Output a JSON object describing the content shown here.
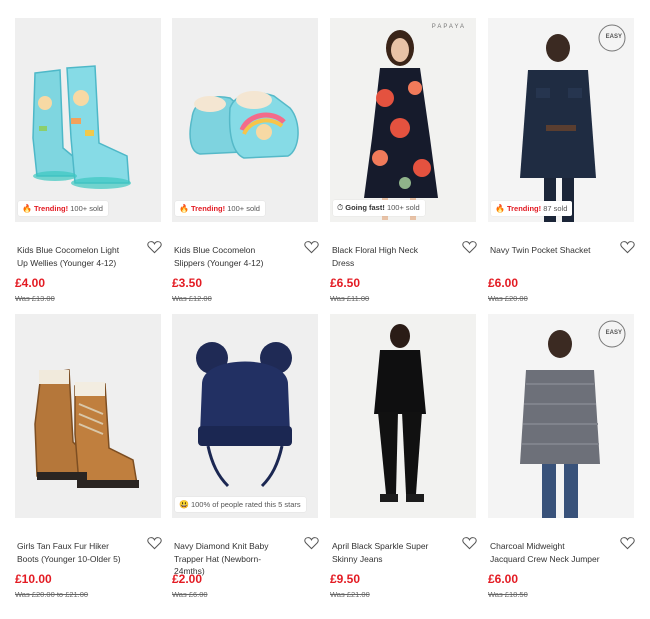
{
  "products": [
    {
      "name": "Kids Blue Cocomelon Light Up Wellies (Younger 4-12)",
      "price": "£4.00",
      "was": "Was £13.00",
      "badge": {
        "icon": "fire-icon",
        "emoji": "🔥",
        "strong": "Trending!",
        "text": "100+ sold"
      }
    },
    {
      "name": "Kids Blue Cocomelon Slippers (Younger 4-12)",
      "price": "£3.50",
      "was": "Was £12.00",
      "badge": {
        "icon": "fire-icon",
        "emoji": "🔥",
        "strong": "Trending!",
        "text": "100+ sold"
      }
    },
    {
      "name": "Black Floral High Neck Dress",
      "price": "£6.50",
      "was": "Was £11.00",
      "brand": "PAPAYA",
      "badge": {
        "icon": "stopwatch-icon",
        "emoji": "⏱",
        "strong": "Going fast!",
        "text": "100+ sold"
      }
    },
    {
      "name": "Navy Twin Pocket Shacket",
      "price": "£6.00",
      "was": "Was £20.00",
      "brand": "EASY",
      "badge": {
        "icon": "fire-icon",
        "emoji": "🔥",
        "strong": "Trending!",
        "text": "87 sold"
      }
    },
    {
      "name": "Girls Tan Faux Fur Hiker Boots (Younger 10-Older 5)",
      "price": "£10.00",
      "was": "Was £20.00 to £21.00"
    },
    {
      "name": "Navy Diamond Knit Baby Trapper Hat (Newborn-24mths)",
      "price": "£2.00",
      "was": "Was £6.00",
      "badge": {
        "icon": "smiley-icon",
        "emoji": "😃",
        "strong": "",
        "text": "100% of people rated this 5 stars"
      }
    },
    {
      "name": "April Black Sparkle Super Skinny Jeans",
      "price": "£9.50",
      "was": "Was £21.00"
    },
    {
      "name": "Charcoal Midweight Jacquard Crew Neck Jumper",
      "price": "£6.00",
      "was": "Was £18.50",
      "brand": "EASY"
    }
  ],
  "colors": {
    "price_red": "#e31b23",
    "badge_red": "#e31b23",
    "text": "#333333",
    "image_bg": "#efefef"
  }
}
